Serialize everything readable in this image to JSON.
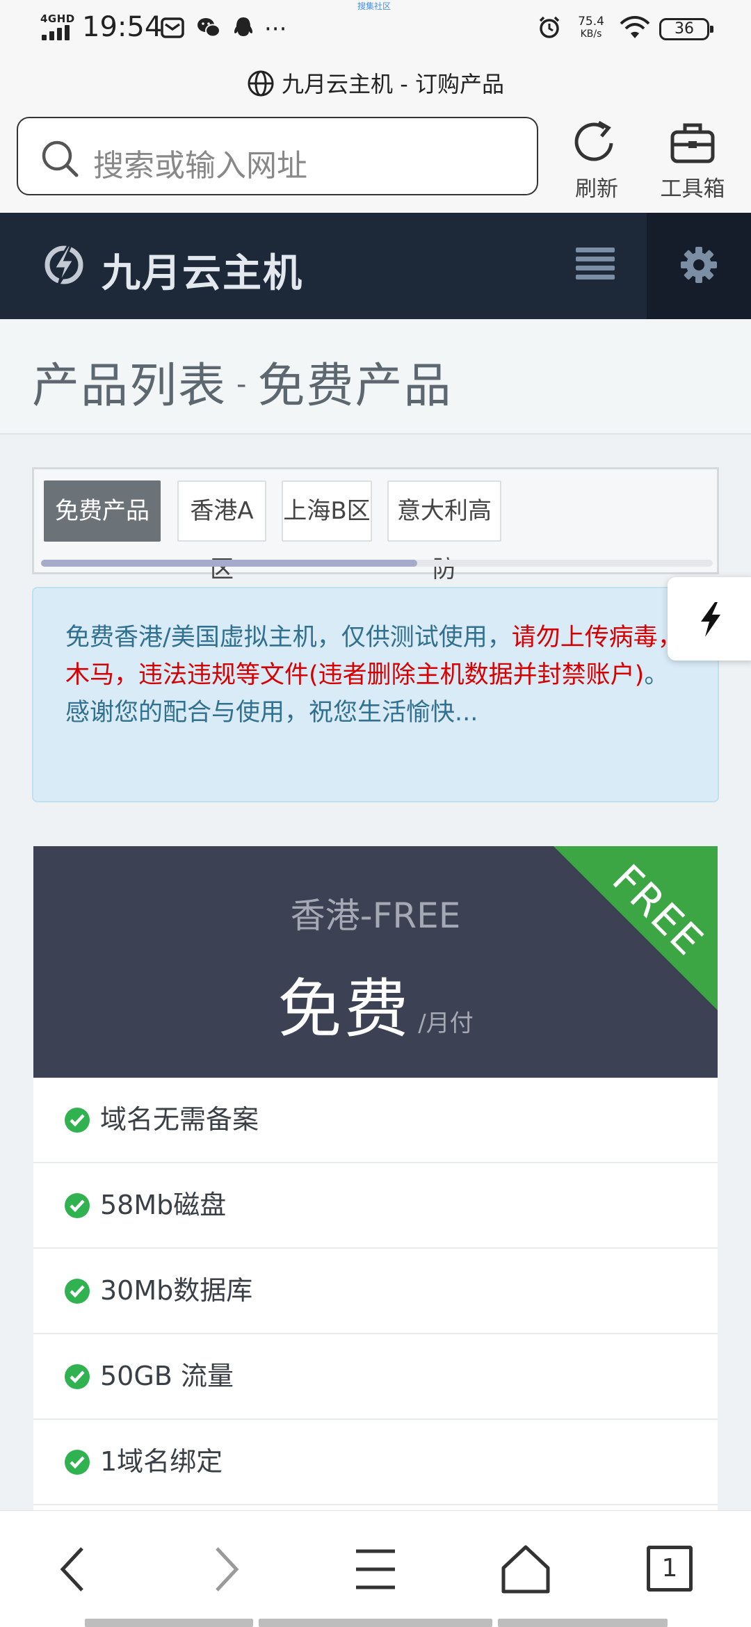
{
  "status_bar": {
    "network": "4GHD",
    "time": "19:54",
    "top_tiny": "搜集社区",
    "speed_value": "75.4",
    "speed_unit": "KB/s",
    "battery": "36"
  },
  "browser": {
    "page_title": "九月云主机 - 订购产品",
    "search_placeholder": "搜索或输入网址",
    "refresh_label": "刷新",
    "toolbox_label": "工具箱"
  },
  "site": {
    "name": "九月云主机"
  },
  "page": {
    "heading_main": "产品列表",
    "heading_sep": "-",
    "heading_sub": "免费产品"
  },
  "tabs": [
    {
      "label": "免费产品",
      "active": true
    },
    {
      "label": "香港A区",
      "active": false
    },
    {
      "label": "上海B区",
      "active": false
    },
    {
      "label": "意大利高防",
      "active": false
    }
  ],
  "tabs_scroll_fraction": 0.56,
  "alert": {
    "text_normal_1": "免费香港/美国虚拟主机，仅供测试使用，",
    "text_red": "请勿上传病毒，木马，违法违规等文件(违者删除主机数据并封禁账户)",
    "text_normal_2": "。感谢您的配合与使用，祝您生活愉快...",
    "close": "×"
  },
  "product": {
    "name": "香港-FREE",
    "price": "免费",
    "period": "/月付",
    "ribbon": "FREE",
    "features": [
      "域名无需备案",
      "58Mb磁盘",
      "30Mb数据库",
      "50GB 流量",
      "1域名绑定"
    ]
  },
  "bottom_nav": {
    "tab_count": "1"
  },
  "colors": {
    "site_header": "#1d2939",
    "card_header": "#3d4154",
    "ribbon": "#3ca644",
    "check": "#2fb24f",
    "alert_text": "#31708f",
    "alert_red": "#d60000"
  }
}
